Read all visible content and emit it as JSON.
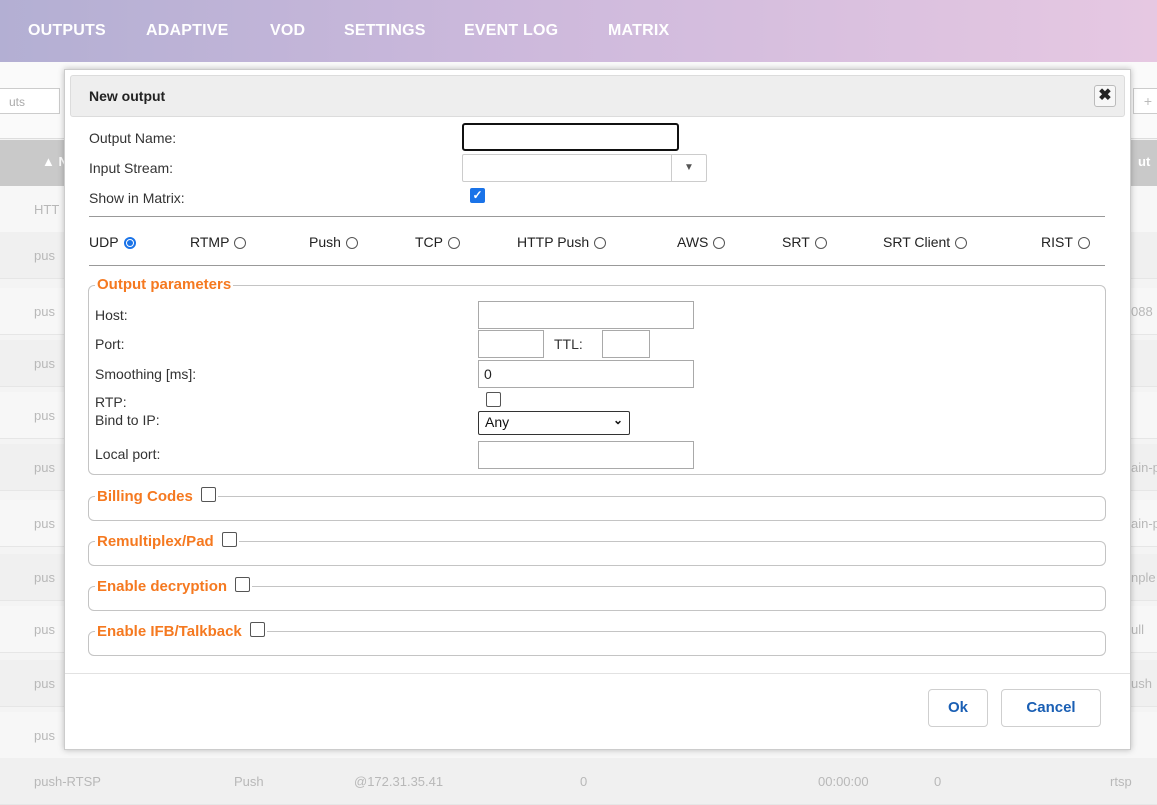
{
  "nav": {
    "items": [
      "OUTPUTS",
      "ADAPTIVE",
      "VOD",
      "SETTINGS",
      "EVENT LOG",
      "MATRIX"
    ]
  },
  "background": {
    "search_placeholder": "uts",
    "add_button": "+",
    "header_col1": "▲ N",
    "header_col9": "ut",
    "rows": [
      {
        "name": "HTT",
        "tail": ""
      },
      {
        "name": "pus",
        "tail": ""
      },
      {
        "name": "pus",
        "tail": "088"
      },
      {
        "name": "pus",
        "tail": ""
      },
      {
        "name": "pus",
        "tail": ""
      },
      {
        "name": "pus",
        "tail": "ain-p"
      },
      {
        "name": "pus",
        "tail": "ain-p"
      },
      {
        "name": "pus",
        "tail": "nple"
      },
      {
        "name": "pus",
        "tail": "ull"
      },
      {
        "name": "pus",
        "tail": "ush"
      },
      {
        "name": "pus",
        "tail": ""
      }
    ],
    "last_row": [
      "push-RTSP",
      "Push",
      "@172.31.35.41",
      "0",
      "00:00:00",
      "0",
      "rtsp"
    ]
  },
  "modal": {
    "title": "New output",
    "close_label": "✖",
    "output_name_label": "Output Name:",
    "output_name_value": "",
    "input_stream_label": "Input Stream:",
    "input_stream_value": "",
    "show_in_matrix_label": "Show in Matrix:",
    "show_in_matrix_checked": true,
    "protocols": [
      "UDP",
      "RTMP",
      "Push",
      "TCP",
      "HTTP Push",
      "AWS",
      "SRT",
      "SRT Client",
      "RIST"
    ],
    "selected_protocol": "UDP",
    "output_parameters": {
      "legend": "Output parameters",
      "host_label": "Host:",
      "host_value": "",
      "port_label": "Port:",
      "port_value": "",
      "ttl_label": "TTL:",
      "ttl_value": "",
      "smoothing_label": "Smoothing [ms]:",
      "smoothing_value": "0",
      "rtp_label": "RTP:",
      "rtp_checked": false,
      "bind_label": "Bind to IP:",
      "bind_value": "Any",
      "local_port_label": "Local port:",
      "local_port_value": ""
    },
    "sections": [
      {
        "label": "Billing Codes",
        "checked": false
      },
      {
        "label": "Remultiplex/Pad",
        "checked": false
      },
      {
        "label": "Enable decryption",
        "checked": false
      },
      {
        "label": "Enable IFB/Talkback",
        "checked": false
      }
    ],
    "ok_label": "Ok",
    "cancel_label": "Cancel"
  },
  "colors": {
    "accent": "#1a73e8",
    "legend_orange": "#f57920",
    "button_text": "#1a5fb4"
  }
}
